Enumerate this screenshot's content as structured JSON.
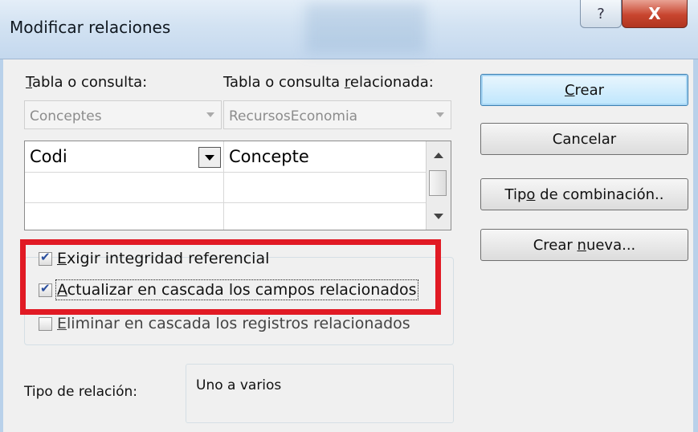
{
  "window": {
    "title": "Modificar relaciones",
    "help_icon": "?",
    "close_icon": "X"
  },
  "left_table": {
    "label_prefix": "",
    "label_u": "T",
    "label_rest": "abla o consulta:",
    "value": "Conceptes"
  },
  "related_table": {
    "label_before": "Tabla o consulta ",
    "label_u": "r",
    "label_after": "elacionada:",
    "value": "RecursosEconomia"
  },
  "grid": {
    "rows": [
      {
        "left": "Codi",
        "right": "Concepte"
      },
      {
        "left": "",
        "right": ""
      },
      {
        "left": "",
        "right": ""
      }
    ]
  },
  "options": {
    "enforce": {
      "u": "E",
      "rest": "xigir integridad referencial",
      "checked": true
    },
    "cascade_update": {
      "u": "A",
      "rest": "ctualizar en cascada los campos relacionados",
      "checked": true
    },
    "cascade_delete": {
      "u": "E",
      "rest": "liminar en cascada los registros relacionados",
      "checked": false
    }
  },
  "relationship": {
    "label": "Tipo de relación:",
    "value": "Uno a varios"
  },
  "buttons": {
    "create": {
      "u": "C",
      "rest": "rear"
    },
    "cancel": {
      "label": "Cancelar"
    },
    "join_type": {
      "before": "Tip",
      "u": "o",
      "after": " de combinación.."
    },
    "create_new": {
      "before": "Crear ",
      "u": "n",
      "after": "ueva..."
    }
  },
  "colors": {
    "highlight": "#e11a24",
    "default_button_border": "#3c7fb1"
  }
}
